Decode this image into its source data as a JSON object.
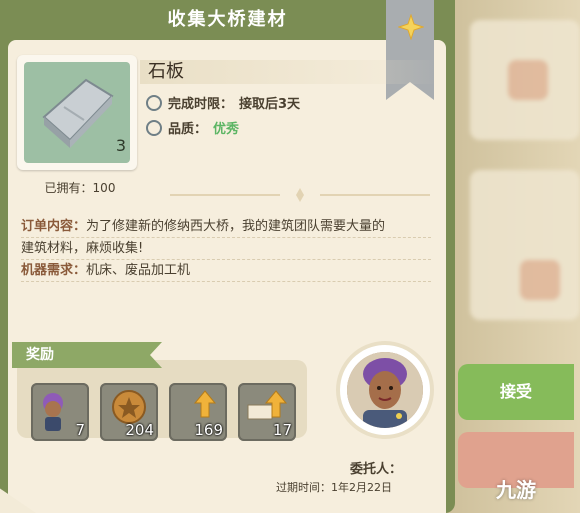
{
  "window": {
    "title": "收集大桥建材"
  },
  "item": {
    "name": "石板",
    "quantity": "3",
    "owned_label": "已拥有：",
    "owned_value": "100",
    "icon": "stone-slab-icon"
  },
  "info": {
    "deadline_label": "完成时限：",
    "deadline_value": "接取后3天",
    "quality_label": "品质：",
    "quality_value": "优秀"
  },
  "order": {
    "content_label": "订单内容：",
    "content_line1": "为了修建新的修纳西大桥，我的建筑团队需要大量的",
    "content_line2": "建筑材料，麻烦收集!",
    "machine_label": "机器需求：",
    "machine_value": "机床、废品加工机"
  },
  "rewards": {
    "label": "奖励",
    "items": [
      {
        "icon": "character-token-icon",
        "value": "7"
      },
      {
        "icon": "gold-coin-icon",
        "value": "204"
      },
      {
        "icon": "experience-icon",
        "value": "169"
      },
      {
        "icon": "workshop-level-icon",
        "value": "17"
      }
    ]
  },
  "client": {
    "label": "委托人：",
    "expire_label": "过期时间：",
    "expire_value": "1年2月22日"
  },
  "actions": {
    "accept_label": "接受"
  },
  "watermark": "九游",
  "colors": {
    "panel_green": "#7b8d54",
    "paper": "#f6eedd",
    "quality": "#5cb564",
    "accept": "#86bb5a",
    "cancel": "#e0a28e"
  }
}
